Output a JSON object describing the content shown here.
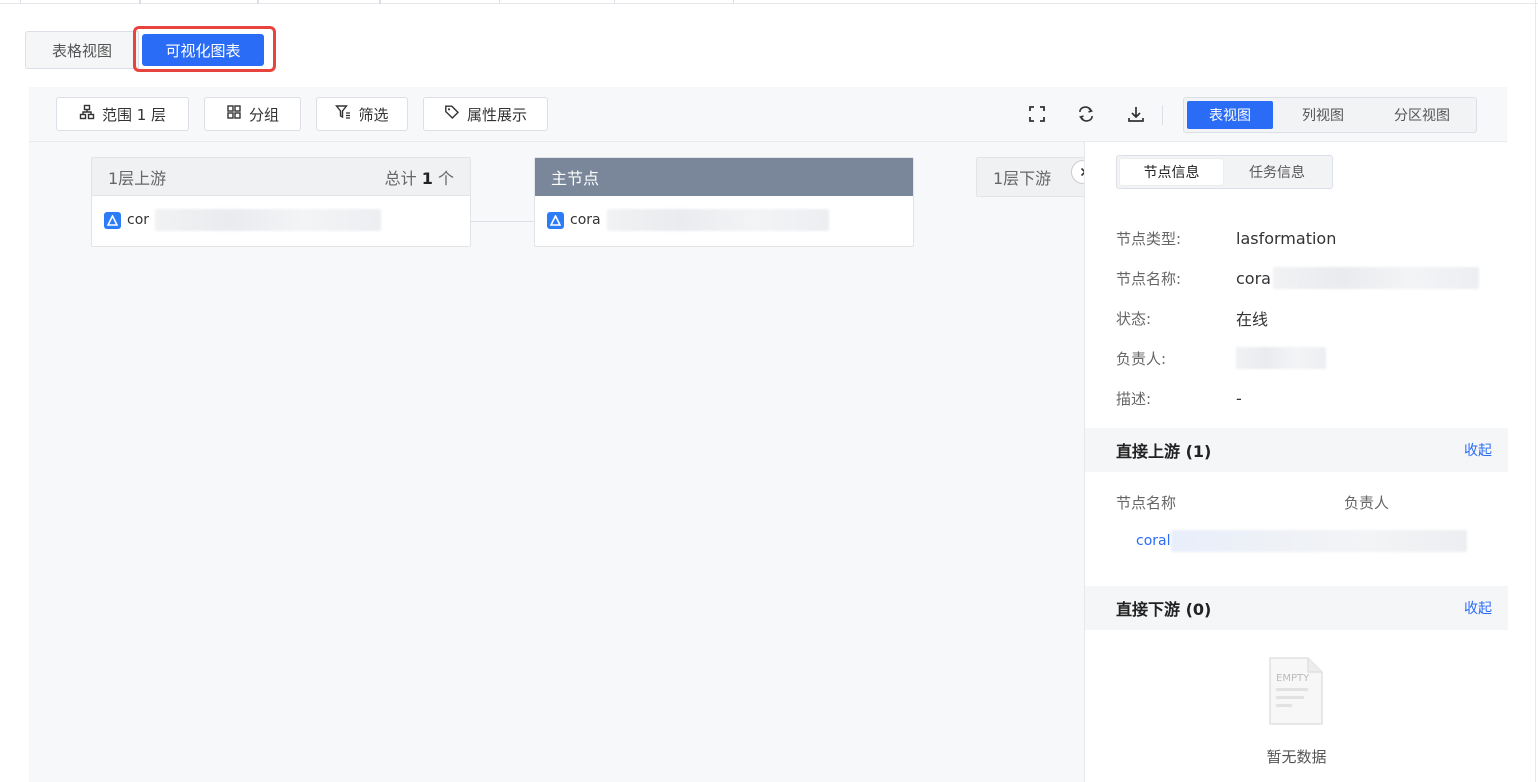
{
  "view_switch": {
    "table_label": "表格视图",
    "chart_label": "可视化图表"
  },
  "toolbar": {
    "scope_label": "范围 1 层",
    "group_label": "分组",
    "filter_label": "筛选",
    "attr_label": "属性展示",
    "views": [
      "表视图",
      "列视图",
      "分区视图"
    ],
    "active_view": "表视图"
  },
  "graph": {
    "upstream": {
      "title": "1层上游",
      "count_prefix": "总计",
      "count": "1",
      "count_suffix": "个",
      "node_label": "cor"
    },
    "main": {
      "title": "主节点",
      "node_label": "cora"
    },
    "downstream": {
      "title": "1层下游"
    }
  },
  "panel": {
    "tabs": [
      "节点信息",
      "任务信息"
    ],
    "active_tab": "节点信息",
    "info": {
      "type_label": "节点类型:",
      "type_value": "lasformation",
      "name_label": "节点名称:",
      "name_value": "cora",
      "status_label": "状态:",
      "status_value": "在线",
      "owner_label": "负责人:",
      "owner_value": "",
      "desc_label": "描述:",
      "desc_value": "-"
    },
    "upstream_section": {
      "title": "直接上游 (1)",
      "collapse": "收起",
      "col_name": "节点名称",
      "col_owner": "负责人",
      "row_name": "coral"
    },
    "downstream_section": {
      "title": "直接下游 (0)",
      "collapse": "收起",
      "empty_text": "暂无数据",
      "empty_image_text": "EMPTY"
    }
  },
  "colors": {
    "primary": "#2b6cf6",
    "highlight_border": "#e8443e",
    "main_node_header": "#7a8699"
  }
}
